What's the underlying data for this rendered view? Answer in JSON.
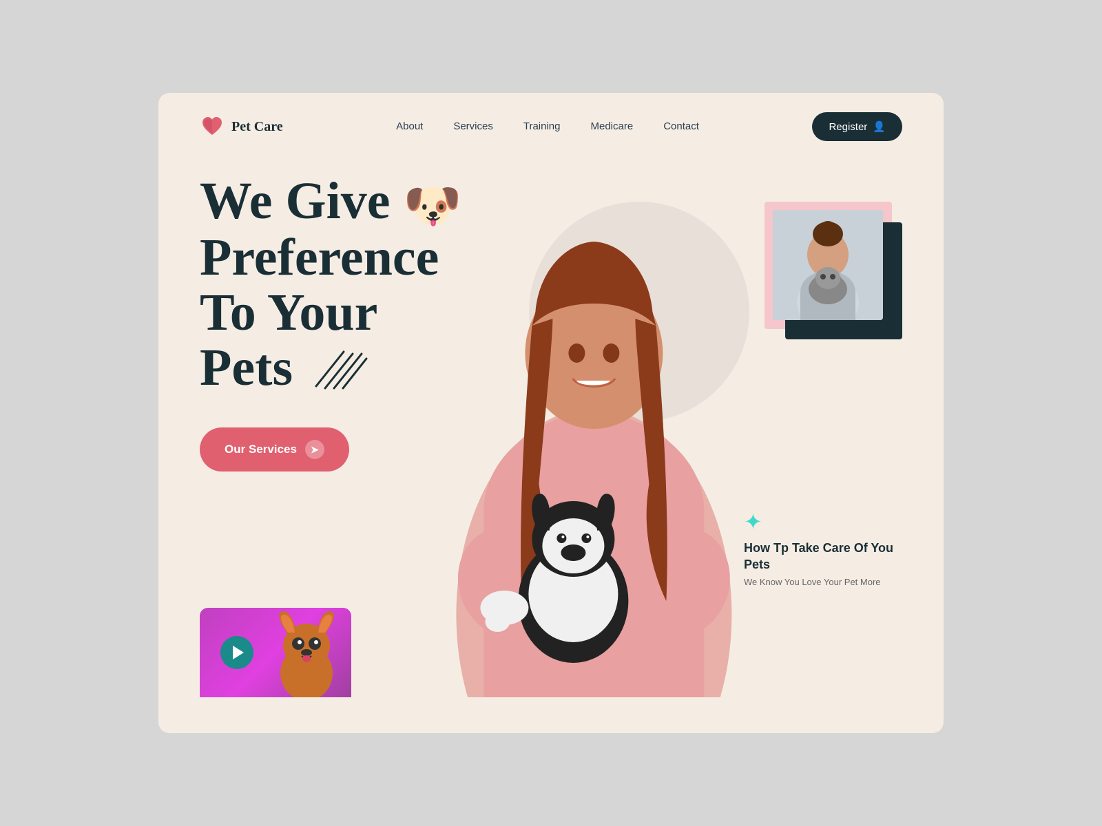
{
  "brand": {
    "name": "Pet Care",
    "logo_emoji": "❤️"
  },
  "nav": {
    "links": [
      "About",
      "Services",
      "Training",
      "Medicare",
      "Contact"
    ],
    "register_label": "Register",
    "register_icon": "👤"
  },
  "hero": {
    "heading_line1": "We Give",
    "heading_emoji": "🐶",
    "heading_line2": "Preference",
    "heading_line3": "To Your",
    "heading_line4": "Pets",
    "cta_label": "Our Services",
    "cta_icon": "→"
  },
  "info_card": {
    "icon": "✦",
    "title": "How Tp Take Care Of You Pets",
    "subtitle": "We Know You Love Your Pet More"
  },
  "video_card": {
    "has_play": true
  },
  "colors": {
    "bg": "#f5ede4",
    "dark": "#1a2e35",
    "pink_btn": "#e06070",
    "card_pink": "#f5c6cb",
    "teal": "#40d9c8",
    "purple": "#c040c0"
  }
}
